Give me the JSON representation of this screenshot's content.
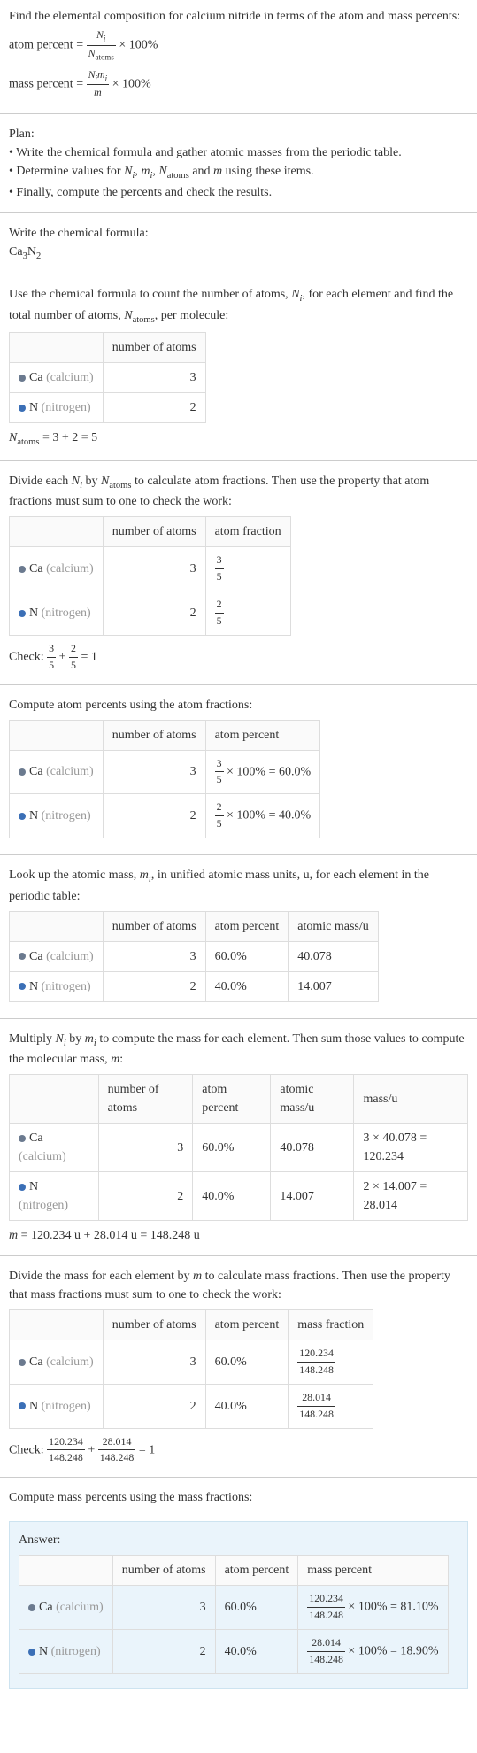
{
  "intro": {
    "line1": "Find the elemental composition for calcium nitride in terms of the atom and mass percents:",
    "atom_percent_lhs": "atom percent",
    "mass_percent_lhs": "mass percent",
    "ni": "N",
    "ni_sub": "i",
    "natoms": "N",
    "natoms_sub": "atoms",
    "nimi_top": "N",
    "mi": "m",
    "mi_sub": "i",
    "m": "m",
    "times100": "× 100%"
  },
  "plan": {
    "title": "Plan:",
    "b1": "• Write the chemical formula and gather atomic masses from the periodic table.",
    "b2_pre": "• Determine values for ",
    "b2_mid": " and ",
    "b2_post": " using these items.",
    "b3": "• Finally, compute the percents and check the results."
  },
  "formula_sec": {
    "title": "Write the chemical formula:",
    "ca": "Ca",
    "ca_sub": "3",
    "n": "N",
    "n_sub": "2"
  },
  "count_sec": {
    "text_pre": "Use the chemical formula to count the number of atoms, ",
    "text_mid": ", for each element and find the total number of atoms, ",
    "text_post": ", per molecule:",
    "hdr_atoms": "number of atoms",
    "ca_label": "Ca",
    "ca_grey": "(calcium)",
    "n_label": "N",
    "n_grey": "(nitrogen)",
    "ca_count": "3",
    "n_count": "2",
    "total_eq": " = 3 + 2 = 5"
  },
  "atomfrac_sec": {
    "text_pre": "Divide each ",
    "text_mid": " by ",
    "text_post": " to calculate atom fractions. Then use the property that atom fractions must sum to one to check the work:",
    "hdr_frac": "atom fraction",
    "ca_frac_num": "3",
    "ca_frac_den": "5",
    "n_frac_num": "2",
    "n_frac_den": "5",
    "check_pre": "Check: ",
    "check_eq": " = 1"
  },
  "atompct_sec": {
    "title": "Compute atom percents using the atom fractions:",
    "hdr_pct": "atom percent",
    "ca_pct": " × 100% = 60.0%",
    "n_pct": " × 100% = 40.0%"
  },
  "atomicmass_sec": {
    "text_pre": "Look up the atomic mass, ",
    "text_post": ", in unified atomic mass units, u, for each element in the periodic table:",
    "hdr_mass": "atomic mass/u",
    "ca_pct_v": "60.0%",
    "n_pct_v": "40.0%",
    "ca_mass": "40.078",
    "n_mass": "14.007"
  },
  "molmass_sec": {
    "text_pre": "Multiply ",
    "text_mid": " by ",
    "text_mid2": " to compute the mass for each element. Then sum those values to compute the molecular mass, ",
    "text_post": ":",
    "hdr_massu": "mass/u",
    "ca_calc": "3 × 40.078 = 120.234",
    "n_calc": "2 × 14.007 = 28.014",
    "total": " = 120.234 u + 28.014 u = 148.248 u"
  },
  "massfrac_sec": {
    "text": "Divide the mass for each element by ",
    "text_post": " to calculate mass fractions. Then use the property that mass fractions must sum to one to check the work:",
    "hdr_mfrac": "mass fraction",
    "ca_num": "120.234",
    "n_num": "28.014",
    "den": "148.248",
    "check_eq": " = 1"
  },
  "masspct_sec": {
    "title": "Compute mass percents using the mass fractions:"
  },
  "answer": {
    "title": "Answer:",
    "hdr_mpct": "mass percent",
    "ca_calc": " × 100% = 81.10%",
    "n_calc": " × 100% = 18.90%"
  },
  "chart_data": {
    "type": "table",
    "title": "Elemental composition of calcium nitride (Ca3N2)",
    "elements": [
      {
        "symbol": "Ca",
        "name": "calcium",
        "atoms": 3,
        "atom_fraction": "3/5",
        "atom_percent": 60.0,
        "atomic_mass_u": 40.078,
        "mass_u": 120.234,
        "mass_fraction": "120.234/148.248",
        "mass_percent": 81.1
      },
      {
        "symbol": "N",
        "name": "nitrogen",
        "atoms": 2,
        "atom_fraction": "2/5",
        "atom_percent": 40.0,
        "atomic_mass_u": 14.007,
        "mass_u": 28.014,
        "mass_fraction": "28.014/148.248",
        "mass_percent": 18.9
      }
    ],
    "N_atoms": 5,
    "molecular_mass_u": 148.248
  }
}
